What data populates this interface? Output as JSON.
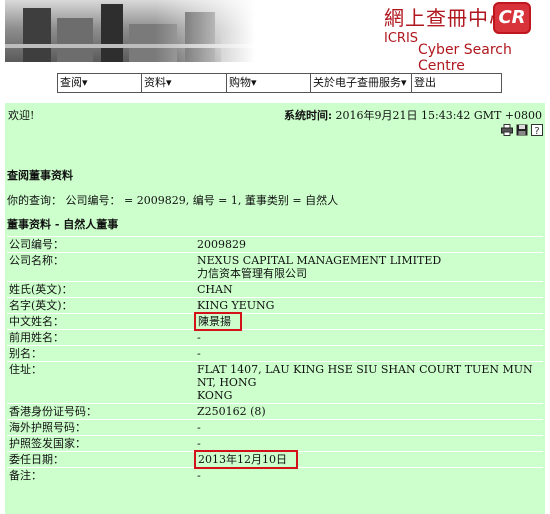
{
  "header": {
    "brand_zh": "網上查冊中心",
    "brand_logo": "CR",
    "brand_icris": "ICRIS",
    "brand_cyber": "Cyber Search Centre"
  },
  "nav": [
    {
      "label": "查阅▾"
    },
    {
      "label": "资料▾"
    },
    {
      "label": "购物▾"
    },
    {
      "label": "关於电子查冊服务▾"
    },
    {
      "label": "登出"
    }
  ],
  "welcome": "欢迎!",
  "systime": {
    "label": "系统时间:",
    "value": "2016年9月21日 15:43:42 GMT +0800"
  },
  "toolbar_icons": [
    "printer-icon",
    "save-icon",
    "help-icon"
  ],
  "query_heading": "查阅董事资料",
  "query_line": "你的查询： 公司编号： = 2009829, 编号 = 1, 董事类别 = 自然人",
  "director_heading": "董事资料 - 自然人董事",
  "rows": [
    {
      "label": "公司编号：",
      "value": "2009829"
    },
    {
      "label": "公司名称：",
      "value": "NEXUS CAPITAL MANAGEMENT LIMITED",
      "value2": "力信资本管理有限公司"
    },
    {
      "label": "姓氏(英文)：",
      "value": "CHAN"
    },
    {
      "label": "名字(英文)：",
      "value": "KING YEUNG"
    },
    {
      "label": "中文姓名：",
      "value": "陳景揚",
      "highlight": true
    },
    {
      "label": "前用姓名：",
      "value": "-"
    },
    {
      "label": "别名：",
      "value": "-"
    },
    {
      "label": "住址：",
      "value": "FLAT 1407, LAU KING HSE SIU SHAN COURT TUEN MUN NT, HONG",
      "value2": "KONG"
    },
    {
      "label": "香港身份证号码：",
      "value": "Z250162 (8)"
    },
    {
      "label": "海外护照号码：",
      "value": "-"
    },
    {
      "label": "护照签发国家：",
      "value": "-"
    },
    {
      "label": "委任日期：",
      "value": "2013年12月10日",
      "highlight": true
    },
    {
      "label": "备注：",
      "value": "-"
    }
  ],
  "colors": {
    "content_bg": "#ccffcc",
    "highlight_border": "#d4121a",
    "brand": "#b0171f"
  }
}
